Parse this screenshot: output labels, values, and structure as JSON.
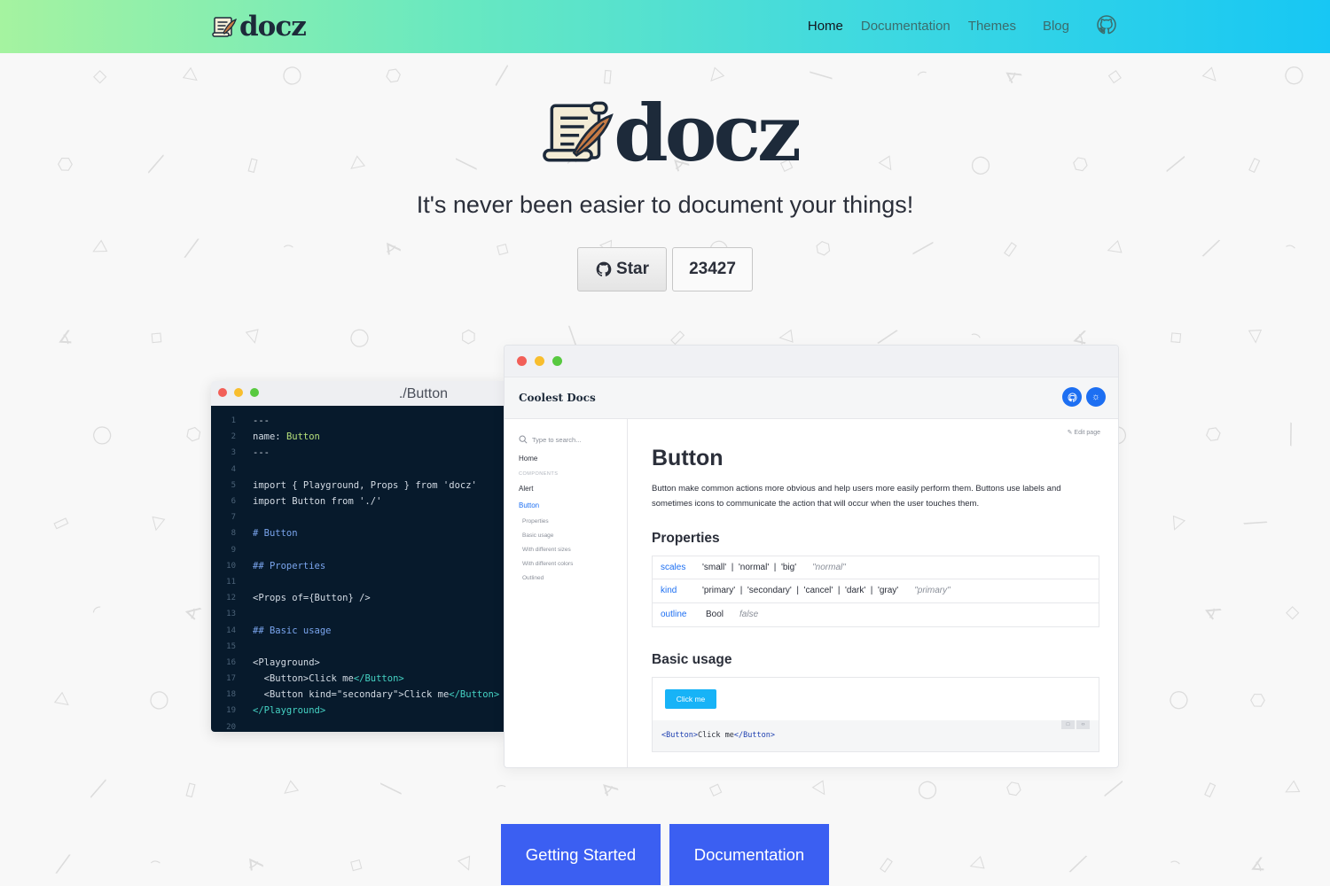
{
  "header": {
    "logo_text": "docz",
    "nav": [
      {
        "label": "Home",
        "active": true
      },
      {
        "label": "Documentation",
        "active": false
      },
      {
        "label": "Themes",
        "active": false
      },
      {
        "label": "Blog",
        "active": false
      }
    ],
    "github_icon": "github-icon"
  },
  "hero": {
    "logo_text": "docz",
    "tagline": "It's never been easier to document your things!",
    "star_label": "Star",
    "star_count": "23427"
  },
  "editor": {
    "title": "./Button",
    "lines": [
      {
        "n": "1",
        "text": "---"
      },
      {
        "n": "2",
        "key": "name",
        "value": "Button"
      },
      {
        "n": "3",
        "text": "---"
      },
      {
        "n": "4",
        "text": ""
      },
      {
        "n": "5",
        "text": "import { Playground, Props } from 'docz'"
      },
      {
        "n": "6",
        "text": "import Button from './'"
      },
      {
        "n": "7",
        "text": ""
      },
      {
        "n": "8",
        "heading": "# Button"
      },
      {
        "n": "9",
        "text": ""
      },
      {
        "n": "10",
        "heading": "## Properties"
      },
      {
        "n": "11",
        "text": ""
      },
      {
        "n": "12",
        "text": "<Props of={Button} />"
      },
      {
        "n": "13",
        "text": ""
      },
      {
        "n": "14",
        "heading": "## Basic usage"
      },
      {
        "n": "15",
        "text": ""
      },
      {
        "n": "16",
        "text": "<Playground>"
      },
      {
        "n": "17",
        "indent": true,
        "open": "<Button>",
        "inner": "Click me",
        "close": "</Button>"
      },
      {
        "n": "18",
        "indent": true,
        "open": "<Button kind=\"secondary\">",
        "inner": "Click me",
        "close": "</Button>"
      },
      {
        "n": "19",
        "close_only": "</Playground>"
      },
      {
        "n": "20",
        "text": ""
      }
    ]
  },
  "preview": {
    "brand": "Coolest Docs",
    "search_placeholder": "Type to search...",
    "sidebar": {
      "home": "Home",
      "section": "COMPONENTS",
      "items": [
        "Alert",
        "Button"
      ],
      "active": "Button",
      "sub_items": [
        "Properties",
        "Basic usage",
        "With different sizes",
        "With different colors",
        "Outlined"
      ]
    },
    "edit_page": "Edit page",
    "title": "Button",
    "description": "Button make common actions more obvious and help users more easily perform them. Buttons use labels and sometimes icons to communicate the action that will occur when the user touches them.",
    "properties_heading": "Properties",
    "props": [
      {
        "name": "scales",
        "type": "'small'  |  'normal'  |  'big'",
        "default": "\"normal\""
      },
      {
        "name": "kind",
        "type": "'primary'  |  'secondary'  |  'cancel'  |  'dark'  |  'gray'",
        "default": "\"primary\""
      },
      {
        "name": "outline",
        "type": "Bool",
        "default": "false"
      }
    ],
    "basic_usage_heading": "Basic usage",
    "playground_button": "Click me",
    "playground_code_open": "<Button>",
    "playground_code_inner": "Click me",
    "playground_code_close": "</Button>"
  },
  "cta": {
    "getting_started": "Getting Started",
    "documentation": "Documentation"
  },
  "colors": {
    "dot_red": "#f25f58",
    "dot_yellow": "#f8be2e",
    "dot_green": "#58c940",
    "accent_blue": "#1d6ff2",
    "cta_blue": "#3b5ff2"
  }
}
